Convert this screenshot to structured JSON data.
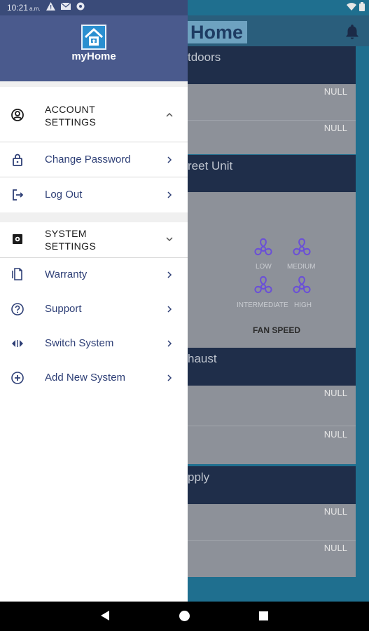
{
  "status_bar": {
    "time": "10:21",
    "time_suffix": "a.m."
  },
  "drawer": {
    "app_name": "myHome",
    "account_group": {
      "title_line1": "ACCOUNT",
      "title_line2": "SETTINGS",
      "items": [
        {
          "label": "Change Password"
        },
        {
          "label": "Log Out"
        }
      ]
    },
    "system_group": {
      "title_line1": "SYSTEM",
      "title_line2": "SETTINGS",
      "items": [
        {
          "label": "Warranty"
        },
        {
          "label": "Support"
        },
        {
          "label": "Switch System"
        },
        {
          "label": "Add New System"
        }
      ]
    }
  },
  "background": {
    "logo_text": "Home",
    "sections": [
      {
        "title": "tdoors",
        "values": [
          "NULL",
          "NULL"
        ]
      },
      {
        "title": "reet Unit"
      },
      {
        "title": "haust",
        "values": [
          "NULL",
          "NULL"
        ]
      },
      {
        "title": "pply",
        "values": [
          "NULL",
          "NULL"
        ]
      }
    ],
    "fan": {
      "levels": [
        "LOW",
        "MEDIUM",
        "INTERMEDIATE",
        "HIGH"
      ],
      "caption": "FAN SPEED"
    }
  },
  "colors": {
    "drawer_header": "#4a5a8d",
    "menu_label": "#2e3f76",
    "backdrop": "#1f6f8f",
    "fan_icon": "#6a4fd8"
  }
}
